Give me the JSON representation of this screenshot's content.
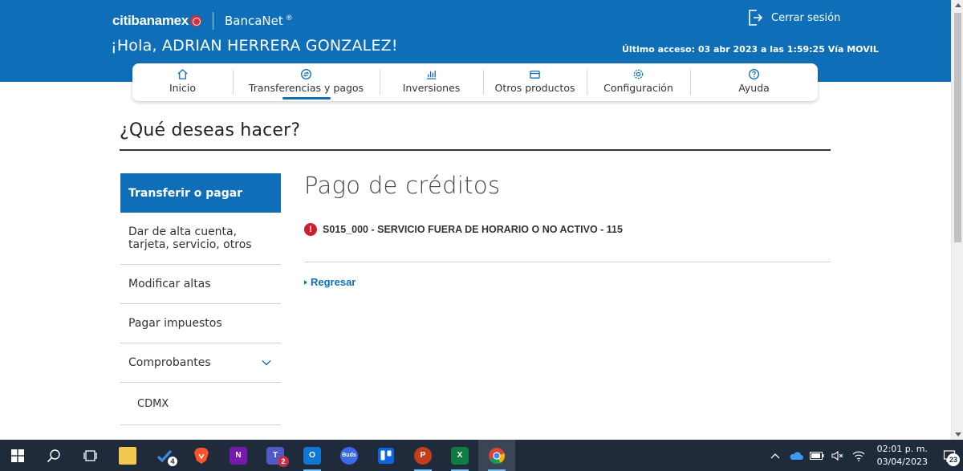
{
  "header": {
    "logo_text": "citibanamex",
    "product": "BancaNet",
    "product_mark": "®",
    "greeting": "¡Hola, ADRIAN HERRERA GONZALEZ!",
    "logout_label": "Cerrar sesión",
    "last_access": "Último acceso: 03 abr 2023 a las 1:59:25 Vía MOVIL",
    "brand_color": "#0e6fb8"
  },
  "nav": {
    "items": [
      {
        "label": "Inicio",
        "icon": "home-icon"
      },
      {
        "label": "Transferencias y pagos",
        "icon": "transfer-icon",
        "active": true
      },
      {
        "label": "Inversiones",
        "icon": "chart-icon"
      },
      {
        "label": "Otros productos",
        "icon": "card-icon"
      },
      {
        "label": "Configuración",
        "icon": "gear-icon"
      },
      {
        "label": "Ayuda",
        "icon": "help-icon"
      }
    ]
  },
  "page": {
    "question": "¿Qué deseas hacer?"
  },
  "sidebar": {
    "items": [
      {
        "label": "Transferir o pagar",
        "active": true
      },
      {
        "label": "Dar de alta cuenta, tarjeta, servicio, otros"
      },
      {
        "label": "Modificar altas"
      },
      {
        "label": "Pagar impuestos"
      },
      {
        "label": "Comprobantes",
        "expandable": true
      },
      {
        "label": "CDMX",
        "sub": true
      }
    ]
  },
  "main": {
    "title": "Pago de créditos",
    "error_icon_glyph": "!",
    "error_message": "S015_000 - SERVICIO FUERA DE HORARIO O NO ACTIVO - 115",
    "back_label": "Regresar",
    "error_color": "#cf1f2e"
  },
  "taskbar": {
    "apps": [
      {
        "name": "file-explorer-icon"
      },
      {
        "name": "todo-icon",
        "badge": "4"
      },
      {
        "name": "brave-icon"
      },
      {
        "name": "onenote-icon",
        "glyph": "N"
      },
      {
        "name": "teams-icon",
        "glyph": "T",
        "badge": "2"
      },
      {
        "name": "outlook-icon",
        "glyph": "O"
      },
      {
        "name": "buds-icon",
        "glyph": "Buds"
      },
      {
        "name": "trello-icon"
      },
      {
        "name": "powerpoint-icon",
        "glyph": "P"
      },
      {
        "name": "excel-icon",
        "glyph": "X"
      },
      {
        "name": "chrome-icon",
        "active": true
      }
    ],
    "time": "02:01 p. m.",
    "date": "03/04/2023",
    "notifications": "23"
  }
}
